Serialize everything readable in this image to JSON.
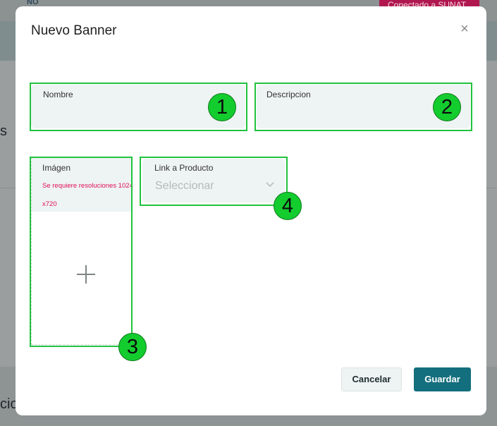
{
  "background": {
    "header_fragment": "NO",
    "status_badge": "Conectado a SUNAT",
    "text_fragment_1": "s",
    "text_fragment_2": "cio"
  },
  "modal": {
    "title": "Nuevo Banner",
    "close_glyph": "×",
    "fields": {
      "nombre_label": "Nombre",
      "descripcion_label": "Descripcion",
      "imagen_label": "Imágen",
      "imagen_warning_line1": "Se requiere resoluciones 1024",
      "imagen_warning_line2": "x720",
      "link_label": "Link a Producto",
      "link_placeholder": "Seleccionar"
    },
    "annotations": [
      "1",
      "2",
      "3",
      "4"
    ],
    "buttons": {
      "cancel": "Cancelar",
      "save": "Guardar"
    }
  },
  "icons": {
    "close": "close-icon",
    "add": "plus-icon",
    "dropdown": "chevron-down-icon"
  },
  "colors": {
    "accent": "#136e7d",
    "warning": "#e0105a",
    "highlight": "#21c23e",
    "badge": "#b0174f"
  }
}
